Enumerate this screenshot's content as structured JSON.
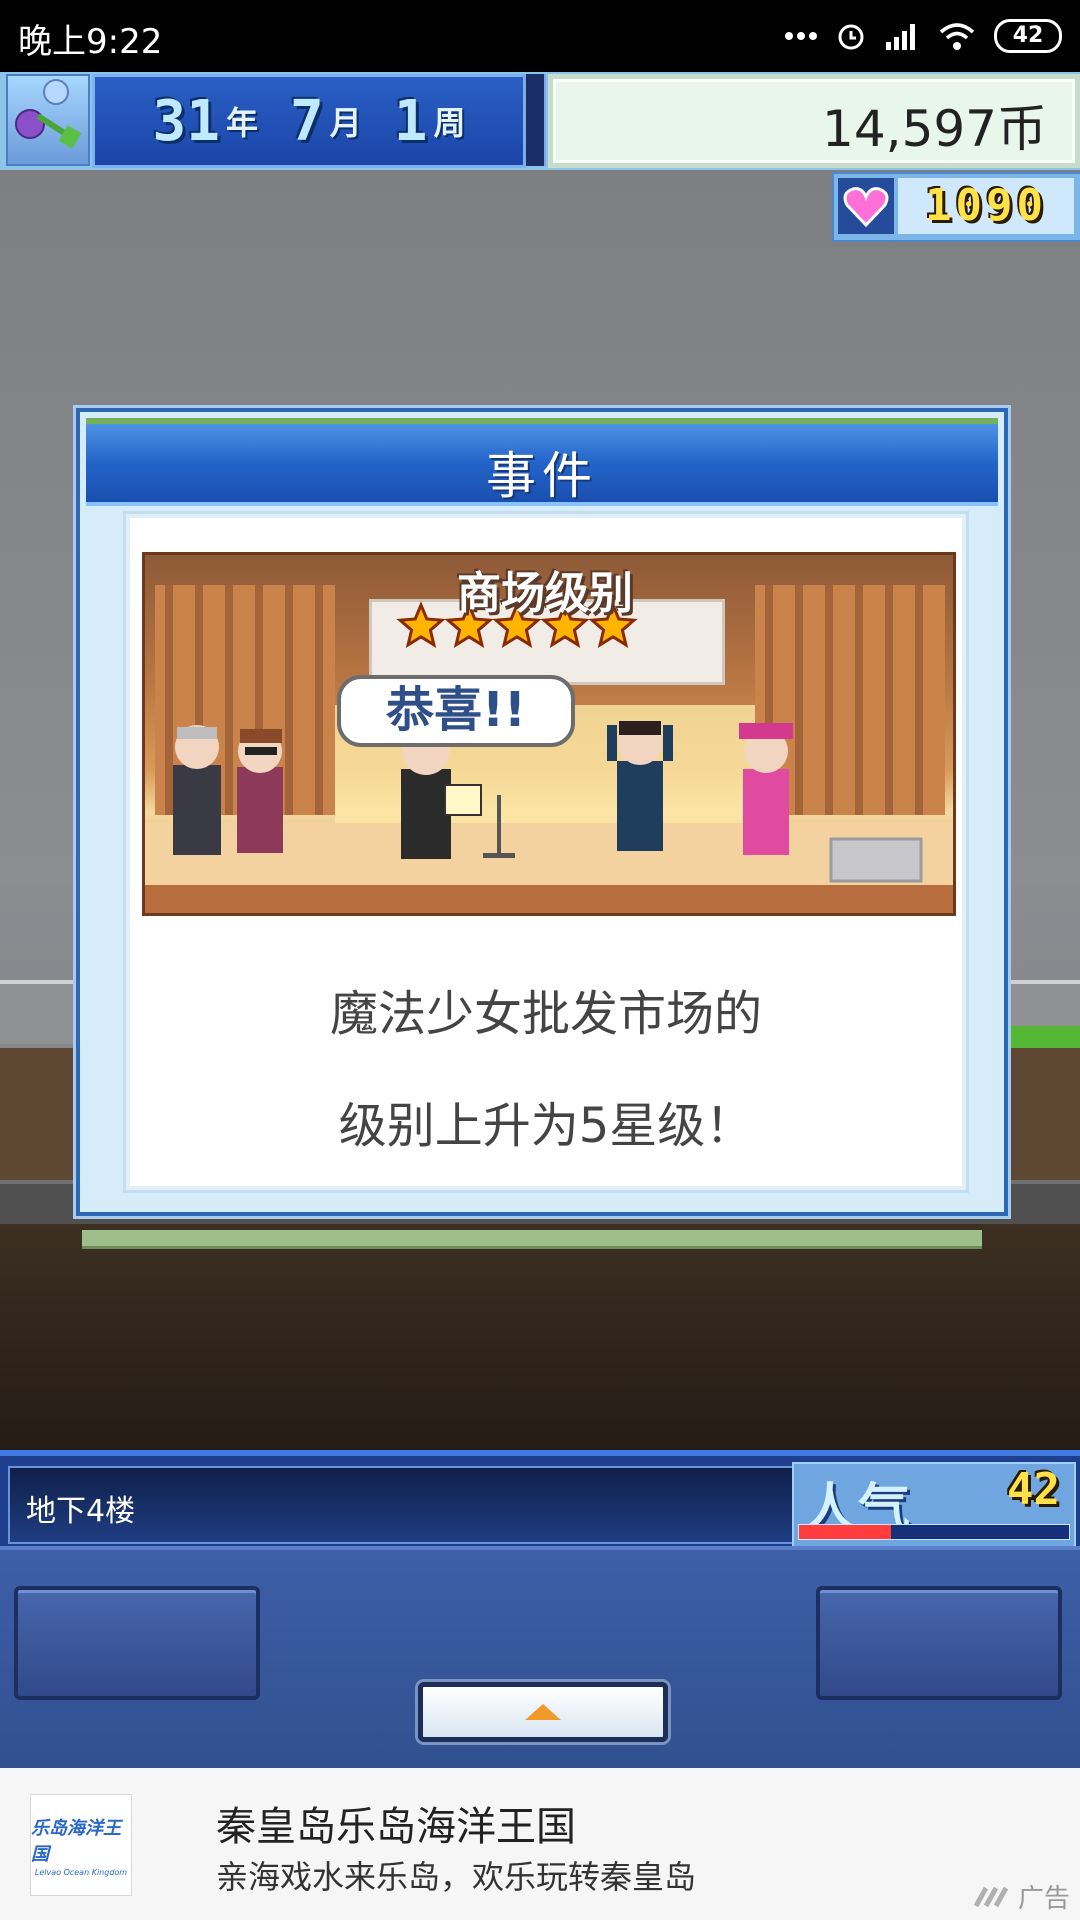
{
  "status_bar": {
    "time": "晚上9:22",
    "battery": "42",
    "icons": [
      "more-dots-icon",
      "alarm-icon",
      "signal-icon",
      "wifi-icon",
      "battery-icon"
    ]
  },
  "hud": {
    "date": {
      "year": "31",
      "year_unit": "年",
      "month": "7",
      "month_unit": "月",
      "week": "1",
      "week_unit": "周"
    },
    "money": "14,597币",
    "hearts": "1090"
  },
  "event_dialog": {
    "title": "事件",
    "scene": {
      "banner_title": "商场级别",
      "stars": 5,
      "bubble_text": "恭喜!!"
    },
    "message_lines": [
      "魔法少女批发市场的",
      "级别上升为5星级！"
    ]
  },
  "floor_bar": {
    "floor_label": "地下4楼",
    "popularity_label": "人气",
    "popularity_value": "42",
    "popularity_fill": 0.34
  },
  "ad": {
    "logo_cn": "乐岛海洋王国",
    "logo_en": "Lelvao Ocean Kingdom",
    "title": "秦皇岛乐岛海洋王国",
    "subtitle": "亲海戏水来乐岛，欢乐玩转秦皇岛",
    "tag": "广告"
  },
  "colors": {
    "accent_blue": "#2364c9",
    "popularity_fill": "#ff3d3d",
    "heart": "#ff6fd8",
    "star": "#ffb400"
  }
}
